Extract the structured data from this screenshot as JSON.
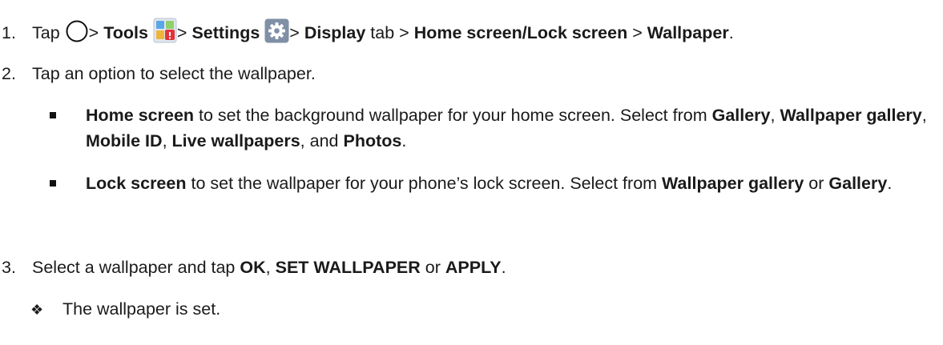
{
  "step1": {
    "num": "1.",
    "tap": "Tap",
    "sep": ">",
    "tools": "Tools",
    "settings": "Settings",
    "display": "Display",
    "tab": "tab",
    "home_lock": "Home screen/Lock screen",
    "wallpaper": "Wallpaper",
    "period": ".",
    "icons": [
      "home-circle-icon",
      "tools-folder-icon",
      "settings-gear-icon"
    ]
  },
  "step2": {
    "num": "2.",
    "text": "Tap an option to select the wallpaper."
  },
  "bullet1": {
    "home_screen": "Home screen",
    "t1": "to set the background wallpaper for your home screen. Select from",
    "gallery": "Gallery",
    "comma": ",",
    "wallpaper_gallery": "Wallpaper gallery",
    "mobile_id": "Mobile ID",
    "live_wallpapers": "Live wallpapers",
    "and": ", and",
    "photos": "Photos",
    "period": "."
  },
  "bullet2": {
    "lock_screen": "Lock screen",
    "t1": "to set the wallpaper for your phone’s lock screen. Select from",
    "wallpaper_gallery": "Wallpaper gallery",
    "or": "or",
    "gallery": "Gallery",
    "period": "."
  },
  "step3": {
    "num": "3.",
    "t1": "Select a wallpaper and tap",
    "ok": "OK",
    "comma": ",",
    "set_wallpaper": "SET WALLPAPER",
    "or": "or",
    "apply": "APPLY",
    "period": "."
  },
  "result": {
    "symbol": "❖",
    "text": "The wallpaper is set."
  },
  "colors": {
    "text": "#1a1a1a",
    "tools_blue": "#3b8fd9",
    "tools_red": "#e2323a",
    "gear_bg": "#7f8fa6"
  }
}
